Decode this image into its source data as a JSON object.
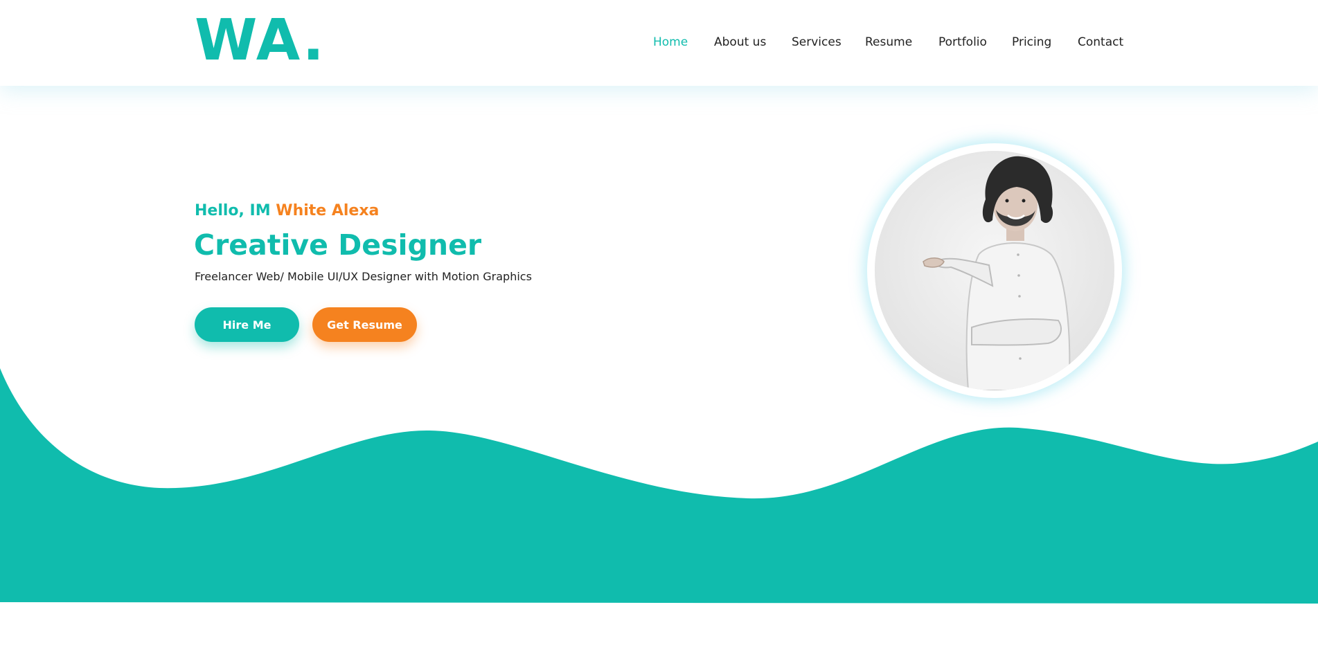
{
  "logo": {
    "text": "WA."
  },
  "nav": {
    "items": [
      {
        "label": "Home",
        "active": true
      },
      {
        "label": "About us",
        "active": false
      },
      {
        "label": "Services",
        "active": false
      },
      {
        "label": "Resume",
        "active": false
      },
      {
        "label": "Portfolio",
        "active": false
      },
      {
        "label": "Pricing",
        "active": false
      },
      {
        "label": "Contact",
        "active": false
      }
    ]
  },
  "hero": {
    "greeting_prefix": "Hello, IM ",
    "greeting_name": "White Alexa",
    "title": "Creative Designer",
    "subtitle": "Freelancer Web/ Mobile UI/UX Designer with Motion Graphics",
    "hire_button": "Hire Me",
    "resume_button": "Get Resume"
  },
  "colors": {
    "brand_teal": "#10bcad",
    "accent_orange": "#f5821f",
    "text_dark": "#222222",
    "background": "#ffffff"
  },
  "icons": {
    "avatar": "profile-photo"
  }
}
